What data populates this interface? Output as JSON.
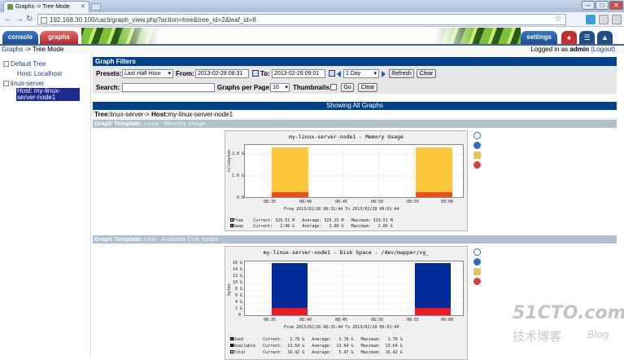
{
  "browser": {
    "tab_title": "Graphs -> Tree Mode",
    "url": "192.168.30.100/cacti/graph_view.php?action=tree&tree_id=2&leaf_id=8"
  },
  "header": {
    "tabs": {
      "console": "console",
      "graphs": "graphs"
    },
    "settings": "settings"
  },
  "breadcrumb": {
    "root": "Graphs",
    "sep": " -> ",
    "current": "Tree Mode"
  },
  "login": {
    "prefix": "Logged in as ",
    "user": "admin",
    "logout": "(Logout)"
  },
  "tree": {
    "items": [
      {
        "label": "Default Tree"
      },
      {
        "label": "Host: Localhost"
      },
      {
        "label": "linux-server"
      },
      {
        "label": "Host: my-linux-server-node1"
      }
    ]
  },
  "filters": {
    "heading": "Graph Filters",
    "presets_label": "Presets:",
    "preset_value": "Last Half Hour",
    "from_label": "From:",
    "from_value": "2013-02-28 08:31",
    "to_label": "To:",
    "to_value": "2013-02-28 09:01",
    "span_value": "1 Day",
    "refresh": "Refresh",
    "clear": "Clear",
    "search_label": "Search:",
    "search_value": "",
    "per_page_label": "Graphs per Page:",
    "per_page_value": "10",
    "thumbnails_label": "Thumbnails:",
    "go": "Go",
    "clear2": "Clear"
  },
  "showing": "Showing All Graphs",
  "tree_line": {
    "tree_label": "Tree:",
    "tree_value": "linux-server",
    "sep": "-> ",
    "host_label": "Host:",
    "host_value": "my-linux-server-node1"
  },
  "graphs": [
    {
      "template_label": "Graph Template:",
      "template_value": "Linux - Memory Usage",
      "title": "my-linux-server-node1 - Memory Usage",
      "y_label": "kilobytes",
      "y_ticks": [
        "2.0 G",
        "1.0 G",
        "0.0"
      ],
      "x_ticks": [
        "08:35",
        "08:40",
        "08:45",
        "08:50",
        "08:55",
        "09:00"
      ],
      "period": "From 2013/02/28 08:31:44 To 2013/02/28 09:01:44",
      "legend": [
        {
          "name": "Free",
          "current": "329.51 M",
          "average": "325.25 M",
          "maximum": "329.51 M"
        },
        {
          "name": "Swap",
          "current": "2.00 G",
          "average": "2.00 G",
          "maximum": "2.00 G"
        }
      ],
      "colors": {
        "free": "#ffc73b",
        "swap": "#ee5019"
      }
    },
    {
      "template_label": "Graph Template:",
      "template_value": "Unix - Available Disk Space",
      "title": "my-linux-server-node1 - Disk Space - /dev/mapper/vg_",
      "y_label": "bytes",
      "y_ticks": [
        "16 G",
        "14 G",
        "12 G",
        "10 G",
        "8 G",
        "6 G",
        "4 G",
        "2 G",
        "0"
      ],
      "x_ticks": [
        "08:35",
        "08:40",
        "08:45",
        "08:50",
        "08:55",
        "09:00"
      ],
      "period": "From 2013/02/28 08:31:44 To 2013/02/28 09:01:44",
      "legend": [
        {
          "name": "Used",
          "current": "2.78 G",
          "average": "2.78 G",
          "maximum": "2.78 G"
        },
        {
          "name": "Available",
          "current": "13.64 G",
          "average": "13.64 G",
          "maximum": "13.64 G"
        },
        {
          "name": "Total",
          "current": "16.42 G",
          "average": "5.47 G",
          "maximum": "16.42 G"
        }
      ],
      "colors": {
        "used": "#ea1b27",
        "available": "#002a97"
      }
    }
  ],
  "legend_headers": {
    "current": "Current:",
    "average": "Average:",
    "maximum": "Maximum:"
  },
  "watermark": {
    "main": "51CTO.com",
    "sub": "技术博客",
    "blog": "Blog"
  }
}
